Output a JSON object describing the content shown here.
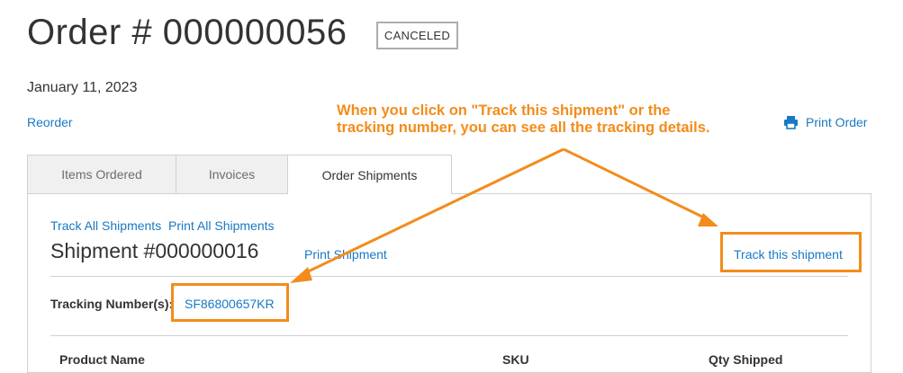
{
  "order": {
    "title": "Order # 000000056",
    "status": "CANCELED",
    "date": "January 11, 2023",
    "reorder_label": "Reorder",
    "print_order_label": "Print Order"
  },
  "annotation": {
    "line1": "When you click on \"Track this shipment\" or the",
    "line2": "tracking number, you can see all the tracking details."
  },
  "tabs": [
    {
      "label": "Items Ordered"
    },
    {
      "label": "Invoices"
    },
    {
      "label": "Order Shipments"
    }
  ],
  "shipments": {
    "track_all_label": "Track All Shipments",
    "print_all_label": "Print All Shipments",
    "shipment_title": "Shipment #000000016",
    "print_shipment_label": "Print Shipment",
    "track_this_label": "Track this shipment",
    "tracking_label": "Tracking Number(s):",
    "tracking_number": "SF86800657KR",
    "columns": [
      "Product Name",
      "SKU",
      "Qty Shipped"
    ]
  },
  "colors": {
    "link": "#1979c3",
    "annotation": "#f38c1b"
  }
}
